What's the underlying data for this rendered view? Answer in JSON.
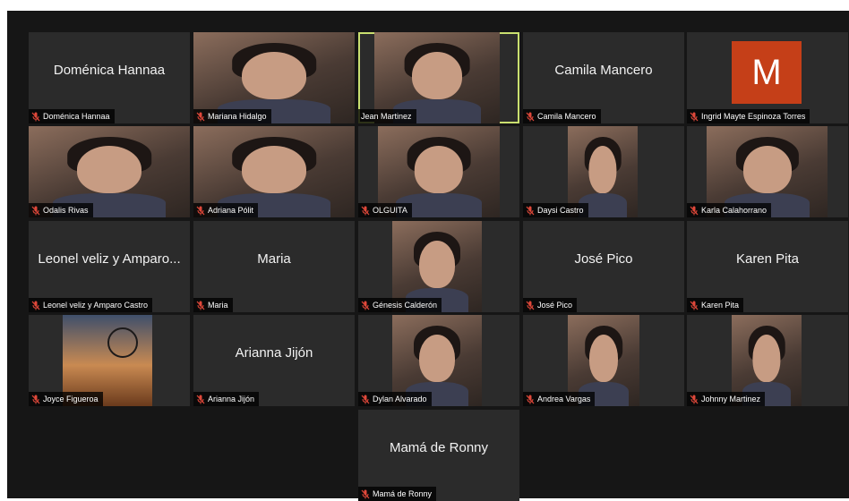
{
  "colors": {
    "background": "#161616",
    "tile": "#2b2b2b",
    "active_border": "#c9df6f",
    "muted_mic": "#e0483a",
    "avatar_m": "#c53f18"
  },
  "participants": [
    {
      "display_name": "Doménica Hannaa",
      "label": "Doménica Hannaa",
      "has_video": false,
      "muted": true
    },
    {
      "display_name": "",
      "label": "Mariana Hidalgo",
      "has_video": true,
      "muted": true
    },
    {
      "display_name": "",
      "label": "Jean Martinez",
      "has_video": true,
      "muted": false,
      "active_speaker": true
    },
    {
      "display_name": "Camila Mancero",
      "label": "Camila Mancero",
      "has_video": false,
      "muted": true
    },
    {
      "display_name": "",
      "label": "Ingrid Mayte Espinoza Torres",
      "has_video": false,
      "avatar_letter": "M",
      "muted": true
    },
    {
      "display_name": "",
      "label": "Odalis Rivas",
      "has_video": true,
      "muted": true
    },
    {
      "display_name": "",
      "label": "Adriana Pólit",
      "has_video": true,
      "muted": true
    },
    {
      "display_name": "",
      "label": "OLGUITA",
      "has_video": true,
      "muted": true
    },
    {
      "display_name": "",
      "label": "Daysi Castro",
      "has_video": true,
      "muted": true
    },
    {
      "display_name": "",
      "label": "Karla Calahorrano",
      "has_video": true,
      "muted": true
    },
    {
      "display_name": "Leonel veliz y Amparo...",
      "label": "Leonel veliz y Amparo Castro",
      "has_video": false,
      "muted": true
    },
    {
      "display_name": "Maria",
      "label": "Maria",
      "has_video": false,
      "muted": true
    },
    {
      "display_name": "",
      "label": "Génesis Calderón",
      "has_video": true,
      "muted": true
    },
    {
      "display_name": "José Pico",
      "label": "José Pico",
      "has_video": false,
      "muted": true
    },
    {
      "display_name": "Karen Pita",
      "label": "Karen Pita",
      "has_video": false,
      "muted": true
    },
    {
      "display_name": "",
      "label": "Joyce Figueroa",
      "has_video": true,
      "muted": true
    },
    {
      "display_name": "Arianna Jijón",
      "label": "Arianna Jijón",
      "has_video": false,
      "muted": true
    },
    {
      "display_name": "",
      "label": "Dylan Alvarado",
      "has_video": true,
      "muted": true
    },
    {
      "display_name": "",
      "label": "Andrea Vargas",
      "has_video": true,
      "muted": true
    },
    {
      "display_name": "",
      "label": "Johnny Martinez",
      "has_video": true,
      "muted": true
    },
    {
      "display_name": "Mamá de Ronny",
      "label": "Mamá de Ronny",
      "has_video": false,
      "muted": true
    }
  ]
}
